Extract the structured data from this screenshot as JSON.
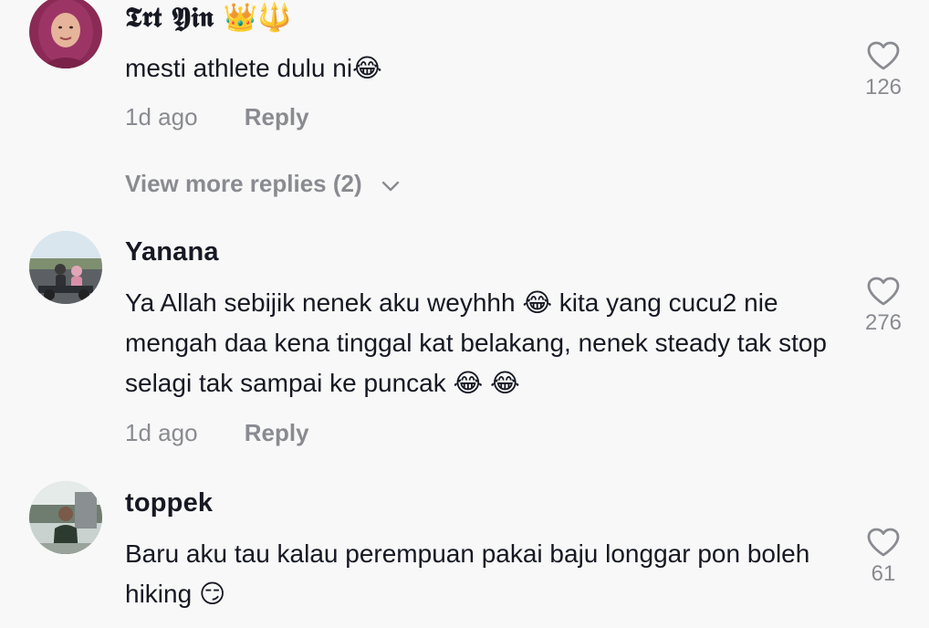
{
  "comments": [
    {
      "username": "𝕿𝖗𝖙 𝖄𝖎𝖓 👑🔱",
      "text": "mesti athlete dulu ni😂",
      "time": "1d ago",
      "reply_label": "Reply",
      "likes": "126",
      "view_more": "View more replies (2)"
    },
    {
      "username": "Yanana",
      "text": "Ya Allah sebijik nenek aku weyhhh 😂  kita yang cucu2 nie mengah daa kena tinggal kat belakang, nenek steady tak stop selagi tak sampai ke puncak 😂 😂",
      "time": "1d ago",
      "reply_label": "Reply",
      "likes": "276"
    },
    {
      "username": "toppek",
      "text": "Baru aku tau kalau perempuan pakai baju longgar pon boleh hiking 😏",
      "likes": "61"
    }
  ],
  "icons": {
    "heart": "heart-outline-icon",
    "chevron": "chevron-down-icon"
  },
  "colors": {
    "background": "#f8f8f8",
    "primary_text": "#161823",
    "secondary_text": "#8a8b91"
  }
}
